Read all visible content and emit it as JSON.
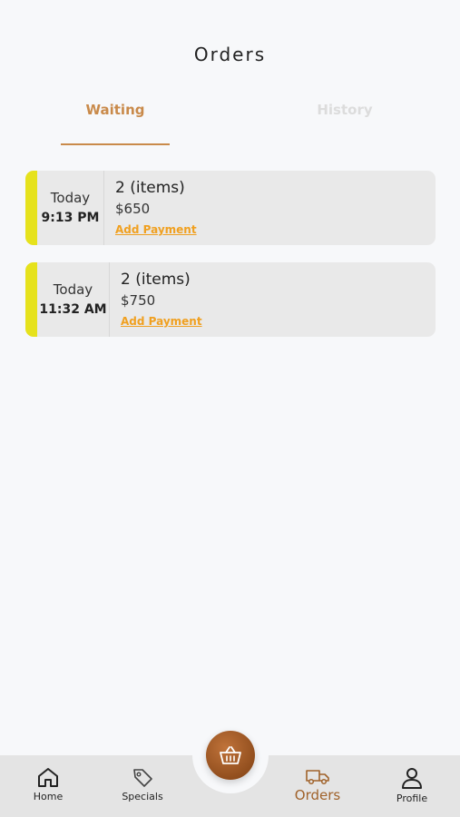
{
  "header": {
    "title": "Orders"
  },
  "tabs": [
    {
      "label": "Waiting"
    },
    {
      "label": "History"
    }
  ],
  "orders": [
    {
      "day": "Today",
      "time": "9:13 PM",
      "items": "2 (items)",
      "price": "$650",
      "action": "Add Payment"
    },
    {
      "day": "Today",
      "time": "11:32 AM",
      "items": "2 (items)",
      "price": "$750",
      "action": "Add Payment"
    }
  ],
  "nav": {
    "home": "Home",
    "specials": "Specials",
    "orders": "Orders",
    "profile": "Profile"
  },
  "colors": {
    "accent": "#c98a4a",
    "card_stripe": "#e6e21c",
    "link": "#f0a020",
    "active_nav": "#a0622a"
  },
  "icons": {
    "home": "home-icon",
    "specials": "tag-icon",
    "orders": "truck-icon",
    "profile": "user-icon",
    "basket": "basket-icon"
  }
}
